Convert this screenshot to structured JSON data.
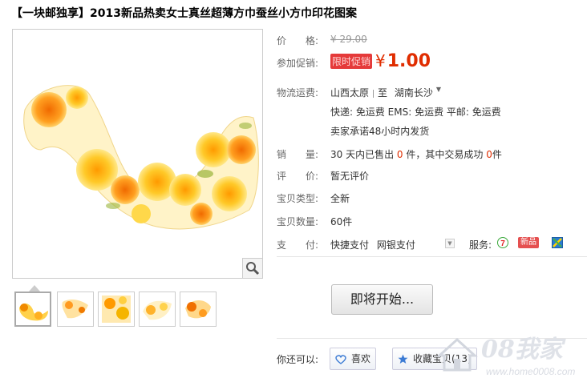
{
  "title": "【一块邮独享】2013新品热卖女士真丝超薄方巾蚕丝小方巾印花图案",
  "price": {
    "label": "价　　格:",
    "original": "¥ 29.00"
  },
  "promo": {
    "label": "参加促销:",
    "tag": "限时促销",
    "currency": "¥",
    "amount": "1.00"
  },
  "shipping": {
    "label": "物流运费:",
    "from": "山西太原",
    "to_word": "至",
    "to": "湖南长沙",
    "fees": "快递: 免运费  EMS: 免运费  平邮: 免运费",
    "promise": "卖家承诺48小时内发货"
  },
  "sales": {
    "label": "销　　量:",
    "prefix": "30 天内已售出",
    "sold": "0",
    "mid": "件，其中交易成功",
    "success": "0",
    "suffix": "件"
  },
  "rating": {
    "label": "评　　价:",
    "value": "暂无评价"
  },
  "type": {
    "label": "宝贝类型:",
    "value": "全新"
  },
  "quantity": {
    "label": "宝贝数量:",
    "value": "60件"
  },
  "payment": {
    "label": "支　　付:",
    "method1": "快捷支付",
    "method2": "网银支付",
    "service_label": "服务:",
    "new_badge": "新品"
  },
  "buy_button": "即将开始...",
  "share": {
    "label": "你还可以:",
    "like": "喜欢",
    "favorite": "收藏宝贝(13)"
  },
  "watermark": {
    "text": "08我家",
    "url": "www.home0008.com"
  },
  "colors": {
    "accent": "#e02d00",
    "promo_tag_bg": "#e53a3a",
    "label": "#666666"
  },
  "icons": [
    "zoom-icon",
    "seven-day-return-icon",
    "new-item-icon",
    "guarantee-icon",
    "heart-icon",
    "star-icon"
  ]
}
